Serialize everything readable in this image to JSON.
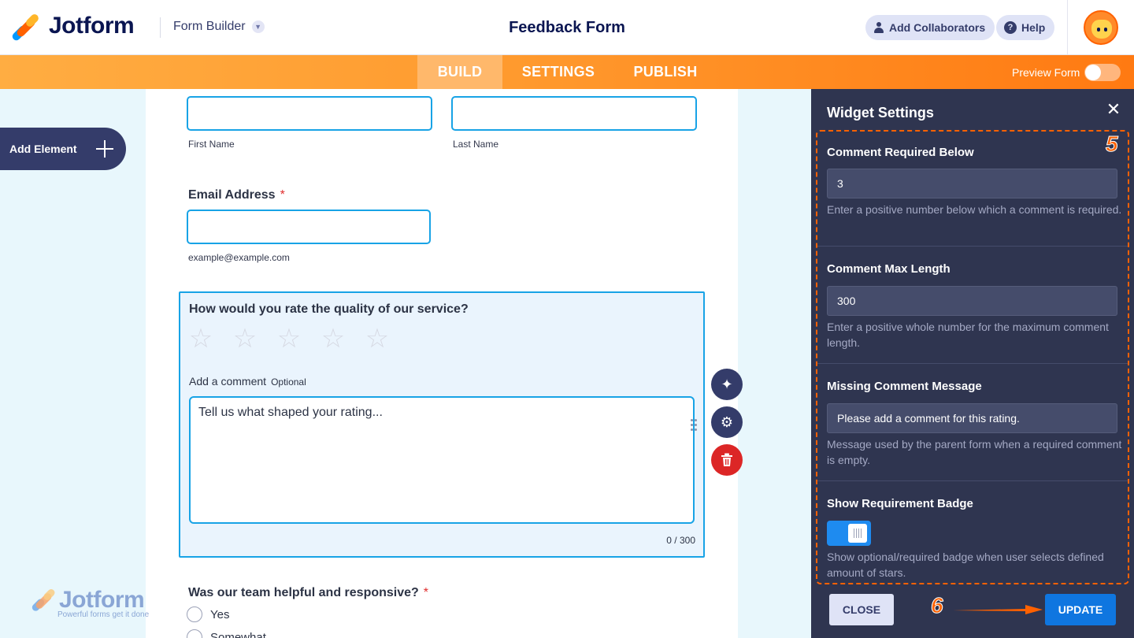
{
  "header": {
    "logo_text": "Jotform",
    "builder_label": "Form Builder",
    "form_title": "Feedback Form",
    "collab_label": "Add Collaborators",
    "help_label": "Help",
    "help_icon": "?"
  },
  "nav": {
    "tabs": [
      "BUILD",
      "SETTINGS",
      "PUBLISH"
    ],
    "active_tab": "BUILD",
    "preview_label": "Preview Form",
    "preview_on": false
  },
  "sidebar": {
    "add_element_label": "Add Element"
  },
  "form": {
    "first_name_label": "First Name",
    "last_name_label": "Last Name",
    "email_label": "Email Address",
    "email_required": "*",
    "email_sublabel": "example@example.com",
    "rating_question": "How would you rate the quality of our service?",
    "star_count": 5,
    "comment_label": "Add a comment",
    "comment_optional": "Optional",
    "comment_placeholder": "Tell us what shaped your rating...",
    "comment_counter": "0 / 300",
    "helpful_question": "Was our team helpful and responsive?",
    "helpful_required": "*",
    "helpful_options": [
      "Yes",
      "Somewhat"
    ]
  },
  "watermark": {
    "text": "Jotform",
    "tagline": "Powerful forms get it done"
  },
  "panel": {
    "title": "Widget Settings",
    "step_badge_settings": "5",
    "step_badge_update": "6",
    "settings": [
      {
        "title": "Comment Required Below",
        "value": "3",
        "help": "Enter a positive number below which a comment is required."
      },
      {
        "title": "Comment Max Length",
        "value": "300",
        "help": "Enter a positive whole number for the maximum comment length."
      },
      {
        "title": "Missing Comment Message",
        "value": "Please add a comment for this rating.",
        "help": "Message used by the parent form when a required comment is empty."
      },
      {
        "title": "Show Requirement Badge",
        "toggle_on": true,
        "help": "Show optional/required badge when user selects defined amount of stars."
      }
    ],
    "close_label": "CLOSE",
    "update_label": "UPDATE"
  },
  "colors": {
    "brand_orange": "#ff6100",
    "accent_blue": "#18a3e6",
    "panel_bg": "#2f3550",
    "navy": "#0a1551"
  }
}
